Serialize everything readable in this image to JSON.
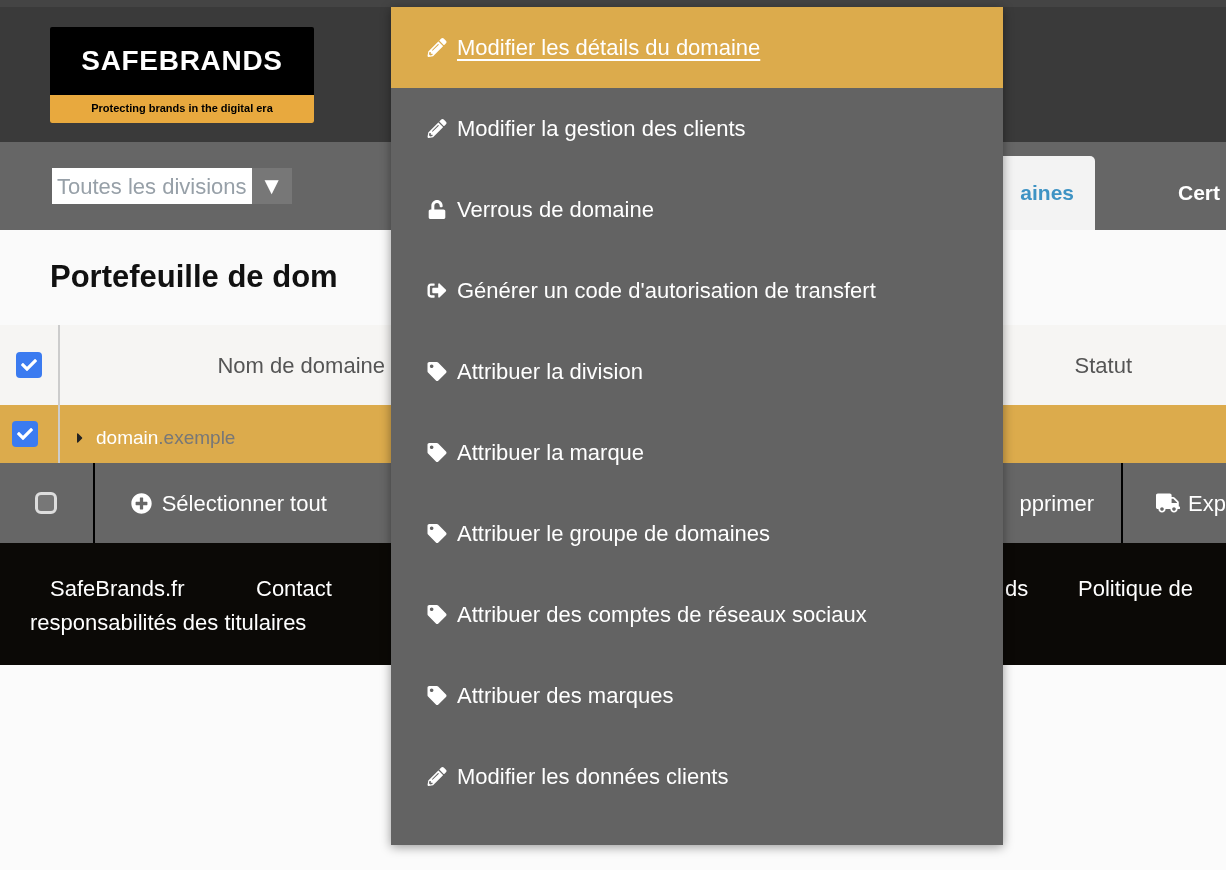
{
  "logo": {
    "name": "SAFEBRANDS",
    "tagline": "Protecting brands in the digital era"
  },
  "division_select": {
    "value": "Toutes les divisions",
    "caret": "▼"
  },
  "tabs": [
    {
      "label": "aines",
      "selected": true
    },
    {
      "label": "Cert",
      "selected": false
    }
  ],
  "page_title": "Portefeuille de dom",
  "table": {
    "select_all_checked": true,
    "columns": [
      "Nom de domaine",
      "Statut"
    ],
    "rows": [
      {
        "name": "domain",
        "extension": ".exemple",
        "checked": true,
        "selected": true
      }
    ]
  },
  "action_bar": {
    "checked": false,
    "actions": [
      {
        "kind": "add",
        "label": "Sélectionner tout"
      },
      {
        "kind": "delete",
        "label": "pprimer"
      },
      {
        "kind": "export",
        "label": "Exp"
      }
    ]
  },
  "footer": {
    "links": [
      "SafeBrands.fr",
      "Contact",
      "ds",
      "Politique de"
    ],
    "second_line": "responsabilités des titulaires"
  },
  "context_menu": [
    {
      "kind": "edit",
      "label": "Modifier les détails du domaine",
      "selected": true
    },
    {
      "kind": "edit",
      "label": "Modifier la gestion des clients",
      "selected": false
    },
    {
      "kind": "lock",
      "label": "Verrous de domaine",
      "selected": false
    },
    {
      "kind": "transfer",
      "label": "Générer un code d'autorisation de transfert",
      "selected": false
    },
    {
      "kind": "assign",
      "label": "Attribuer la division",
      "selected": false
    },
    {
      "kind": "assign",
      "label": "Attribuer la marque",
      "selected": false
    },
    {
      "kind": "assign",
      "label": "Attribuer le groupe de domaines",
      "selected": false
    },
    {
      "kind": "assign",
      "label": "Attribuer des comptes de réseaux sociaux",
      "selected": false
    },
    {
      "kind": "assign",
      "label": "Attribuer des marques",
      "selected": false
    },
    {
      "kind": "edit",
      "label": "Modifier les données clients",
      "selected": false
    }
  ]
}
